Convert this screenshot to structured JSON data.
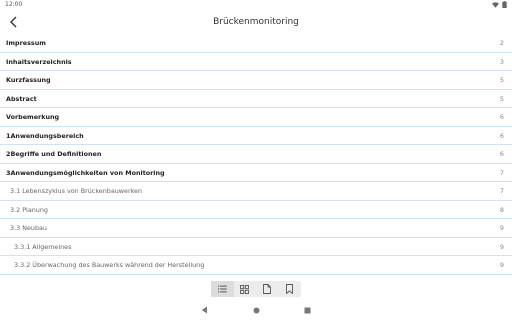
{
  "status_bar": {
    "time": "12:00"
  },
  "app_bar": {
    "title": "Brückenmonitoring"
  },
  "toc": [
    {
      "label": "Impressum",
      "page": "2",
      "level": 1
    },
    {
      "label": "Inhaltsverzeichnis",
      "page": "3",
      "level": 1
    },
    {
      "label": "Kurzfassung",
      "page": "5",
      "level": 1
    },
    {
      "label": "Abstract",
      "page": "5",
      "level": 1
    },
    {
      "label": "Vorbemerkung",
      "page": "6",
      "level": 1
    },
    {
      "label": "1Anwendungsbereich",
      "page": "6",
      "level": 1
    },
    {
      "label": "2Begriffe und Definitionen",
      "page": "6",
      "level": 1
    },
    {
      "label": "3Anwendungsmöglichkeiten von Monitoring",
      "page": "7",
      "level": 1
    },
    {
      "label": "3.1  Lebenszyklus von Brückenbauwerken",
      "page": "7",
      "level": 2
    },
    {
      "label": "3.2  Planung",
      "page": "8",
      "level": 2
    },
    {
      "label": "3.3  Neubau",
      "page": "9",
      "level": 2
    },
    {
      "label": "3.3.1 Allgemeines",
      "page": "9",
      "level": 3
    },
    {
      "label": "3.3.2 Überwachung des Bauwerks während der Herstellung",
      "page": "9",
      "level": 3
    }
  ],
  "bottom_bar": {
    "tabs": [
      "list-icon",
      "grid-icon",
      "page-icon",
      "bookmark-icon"
    ],
    "active": 0
  },
  "colors": {
    "divider": "#cfe3f3",
    "text": "#222222",
    "muted": "#888888"
  }
}
